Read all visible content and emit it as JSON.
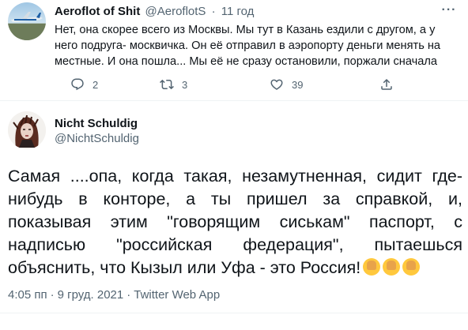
{
  "reply_tweet": {
    "author_name": "Aeroflot of Shit",
    "author_handle": "@AeroflotS",
    "separator": "·",
    "time": "11 год",
    "text": "Нет, она скорее всего из Москвы. Мы тут в Казань ездили с другом, а у него подруга- москвичка. Он её отправил в аэропорту деньги менять на местные. И она пошла... Мы её не сразу остановили, поржали сначала",
    "more_icon": "more-icon",
    "actions": {
      "reply_count": "2",
      "retweet_count": "3",
      "like_count": "39"
    }
  },
  "main_tweet": {
    "author_name": "Nicht Schuldig",
    "author_handle": "@NichtSchuldig",
    "text": "Самая ....опа, когда такая, незамутненная, сидит где-нибудь в конторе, а ты пришел за справкой, и, показывая этим \"говорящим сиськам\" паспорт, с надписью \"российская федерация\", пытаешься объяснить, что Кызыл или Уфа - это Россия!",
    "emoji": [
      "woman-facepalming-icon",
      "woman-facepalming-icon",
      "woman-facepalming-icon"
    ],
    "time": "4:05 пп",
    "date": "9 груд. 2021",
    "source": "Twitter Web App",
    "separator": "·"
  }
}
